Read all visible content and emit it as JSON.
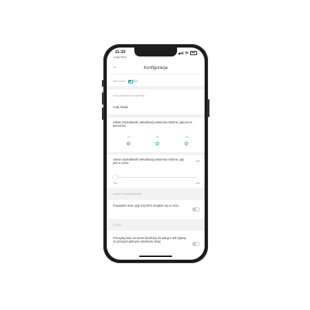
{
  "status_bar": {
    "time": "11:33",
    "back_app": "◂ App Store"
  },
  "header": {
    "title": "Konfiguracja"
  },
  "battery_state": {
    "label": "Stan baterii",
    "value": "92%",
    "level_percent": 92
  },
  "region": {
    "label": "Kraj użytkowania urządzenia",
    "value": "Cały Świat"
  },
  "moving_frequency": {
    "label": "Ustaw częstotliwość aktualizacji położenia notiOne, gdy jest w beznuchu:",
    "options": [
      {
        "label": "1h",
        "selected": true
      },
      {
        "label": "6h",
        "selected": false
      },
      {
        "label": "24h",
        "selected": false
      }
    ]
  },
  "slider_frequency": {
    "label": "Ustaw częstotliwość aktualizacji położenia notiOne, gdy jest w ruchu:",
    "current": "10s",
    "min_label": "10s",
    "max_label": "24h",
    "value_percent": 0
  },
  "theft_alert": {
    "section": "ALERT KRADZIEŻOWY",
    "label": "Powiadom mnie, gdy mój GPS znajdzie się w ruchu",
    "enabled": false
  },
  "etoll": {
    "section": "E-TOLL",
    "label": "Przesyłaj dane na temat lokalizacji do usługi e-toll (opłaty za przejazd płatnymi odcinkami dróg)",
    "enabled": false
  },
  "colors": {
    "accent": "#2aa59a",
    "background": "#f2f2f4",
    "card": "#ffffff",
    "toggle_off": "#c9c9cc"
  },
  "icons": {
    "back": "arrow-left-icon",
    "battery": "battery-icon"
  }
}
